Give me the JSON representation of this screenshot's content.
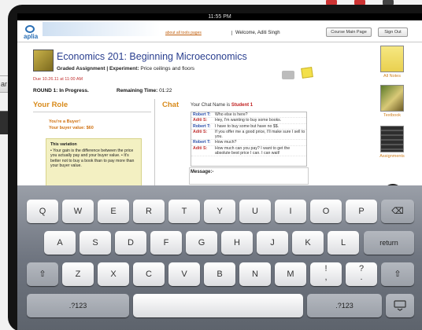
{
  "status_bar": {
    "time": "11:55 PM"
  },
  "header": {
    "logo": "aplia",
    "help_link": "about all tools pages",
    "welcome": "Welcome, Aditi Singh",
    "course_home": "Course Main Page",
    "sign_out": "Sign Out"
  },
  "course": {
    "title": "Economics 201: Beginning Microeconomics",
    "assignment_type": "Graded Assignment | Experiment:",
    "assignment_name": "Price ceilings and floors",
    "due": "Due 10.26.11 at 11:00 AM",
    "round": "ROUND 1: In Progress.",
    "remaining_label": "Remaining Time:",
    "remaining_value": "01:22"
  },
  "role": {
    "heading": "Your Role",
    "line1": "You're a Buyer!",
    "line2": "Your buyer value: $60",
    "variation_title": "This variation",
    "variation_text": "• Your gain is the difference between the price you actually pay and your buyer value. • It's better not to buy a book than to pay more than your buyer value."
  },
  "chat": {
    "heading": "Chat",
    "name_label": "Your Chat Name is",
    "name_value": "Student 1",
    "messages": [
      {
        "who": "Robert T:",
        "text": "Who else is here?"
      },
      {
        "who": "Aditi S:",
        "text": "Hey, I'm wanting to buy some books."
      },
      {
        "who": "Robert T:",
        "text": "I have to buy some but have no $$."
      },
      {
        "who": "Aditi S:",
        "text": "If you offer me a good price, I'll make sure I sell to you."
      },
      {
        "who": "Robert T:",
        "text": "How much?"
      },
      {
        "who": "Aditi S:",
        "text": "How much can you pay? I want to get the absolute best price I can. I can wait!"
      }
    ],
    "message_label": "Message:-"
  },
  "sidebar": {
    "items": [
      {
        "label": "All Notes"
      },
      {
        "label": "Textbook"
      },
      {
        "label": "Assignments"
      }
    ]
  },
  "keyboard": {
    "row1": [
      "Q",
      "W",
      "E",
      "R",
      "T",
      "Y",
      "U",
      "I",
      "O",
      "P"
    ],
    "row2": [
      "A",
      "S",
      "D",
      "F",
      "G",
      "H",
      "J",
      "K",
      "L"
    ],
    "row3": [
      "Z",
      "X",
      "C",
      "V",
      "B",
      "N",
      "M"
    ],
    "return": "return",
    "numbers_left": ".?123",
    "numbers_right": ".?123",
    "shift": "⇧",
    "backspace": "⌫",
    "punct1": "!",
    "punct1_top": ",",
    "punct2": "?",
    "punct2_top": "."
  }
}
